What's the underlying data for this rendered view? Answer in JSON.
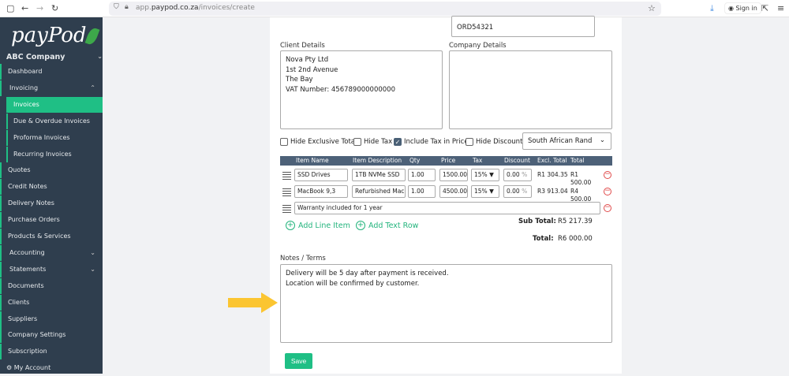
{
  "browser": {
    "url_prefix": "app.",
    "url_domain": "paypod.co.za",
    "url_path": "/invoices/create",
    "sign_in": "Sign in"
  },
  "sidebar": {
    "logo": "payPod",
    "company": "ABC Company",
    "items": [
      {
        "label": "Dashboard"
      },
      {
        "label": "Invoicing"
      },
      {
        "label": "Invoices"
      },
      {
        "label": "Due & Overdue Invoices"
      },
      {
        "label": "Proforma Invoices"
      },
      {
        "label": "Recurring Invoices"
      },
      {
        "label": "Quotes"
      },
      {
        "label": "Credit Notes"
      },
      {
        "label": "Delivery Notes"
      },
      {
        "label": "Purchase Orders"
      },
      {
        "label": "Products & Services"
      },
      {
        "label": "Accounting"
      },
      {
        "label": "Statements"
      },
      {
        "label": "Documents"
      },
      {
        "label": "Clients"
      },
      {
        "label": "Suppliers"
      },
      {
        "label": "Company Settings"
      },
      {
        "label": "Subscription"
      },
      {
        "label": "My Account"
      }
    ]
  },
  "form": {
    "order_number": "ORD54321",
    "client_label": "Client Details",
    "client_lines": [
      "Nova Pty Ltd",
      "1st 2nd Avenue",
      "The Bay",
      "VAT Number: 456789000000000"
    ],
    "company_label": "Company Details",
    "options": {
      "hide_exclusive": "Hide Exclusive Total",
      "hide_tax": "Hide Tax",
      "include_tax": "Include Tax in Price",
      "hide_discount": "Hide Discount",
      "currency": "South African Rand"
    },
    "columns": [
      "Item Name",
      "Item Description",
      "Qty",
      "Price",
      "Tax",
      "Discount",
      "Excl. Total",
      "Total"
    ],
    "rows": [
      {
        "name": "SSD Drives",
        "desc": "1TB NVMe SSD",
        "qty": "1.00",
        "price": "1500.00",
        "tax": "15%",
        "discount": "0.00",
        "pct": "%",
        "excl": "R1 304.35",
        "total": "R1 500.00"
      },
      {
        "name": "MacBook 9,3",
        "desc": "Refurbished MacB",
        "qty": "1.00",
        "price": "4500.00",
        "tax": "15%",
        "discount": "0.00",
        "pct": "%",
        "excl": "R3 913.04",
        "total": "R4 500.00"
      }
    ],
    "text_row": "Warranty included for 1 year",
    "add_line": "Add Line Item",
    "add_text": "Add Text Row",
    "subtotal_label": "Sub Total:",
    "subtotal": "R5 217.39",
    "total_label": "Total:",
    "total": "R6 000.00",
    "notes_label": "Notes / Terms",
    "notes_lines": [
      "Delivery will be 5 day after payment is received.",
      "Location will be confirmed by customer."
    ],
    "save": "Save"
  },
  "colors": {
    "accent": "#1fbf85",
    "sidebar": "#2f3e4e",
    "arrow": "#fbc531"
  }
}
